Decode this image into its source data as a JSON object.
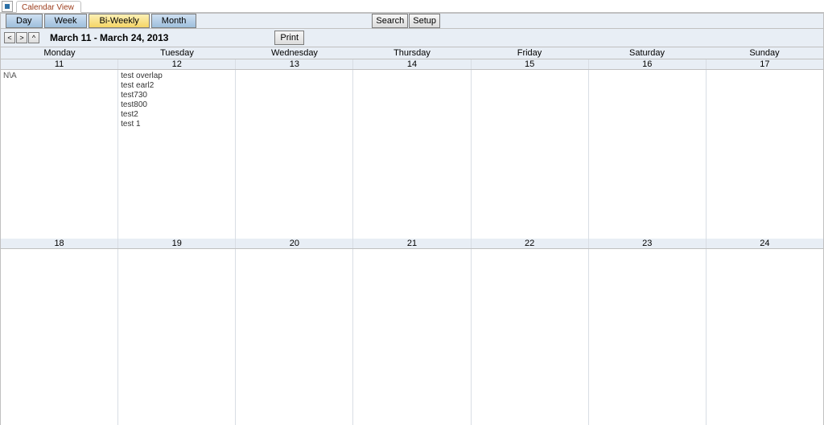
{
  "tab": {
    "label": "Calendar View"
  },
  "views": {
    "day": "Day",
    "week": "Week",
    "biweekly": "Bi-Weekly",
    "month": "Month",
    "active": "biweekly"
  },
  "utils": {
    "search": "Search",
    "setup": "Setup"
  },
  "nav": {
    "prev": "<",
    "next": ">",
    "up": "^"
  },
  "range_title": "March 11 - March 24, 2013",
  "print_label": "Print",
  "weekdays": [
    "Monday",
    "Tuesday",
    "Wednesday",
    "Thursday",
    "Friday",
    "Saturday",
    "Sunday"
  ],
  "dates_row1": [
    "11",
    "12",
    "13",
    "14",
    "15",
    "16",
    "17"
  ],
  "dates_row2": [
    "18",
    "19",
    "20",
    "21",
    "22",
    "23",
    "24"
  ],
  "na_label": "N\\A",
  "day12_events": [
    "test overlap",
    "test earl2",
    "test730",
    "test800",
    "test2",
    "test 1"
  ]
}
